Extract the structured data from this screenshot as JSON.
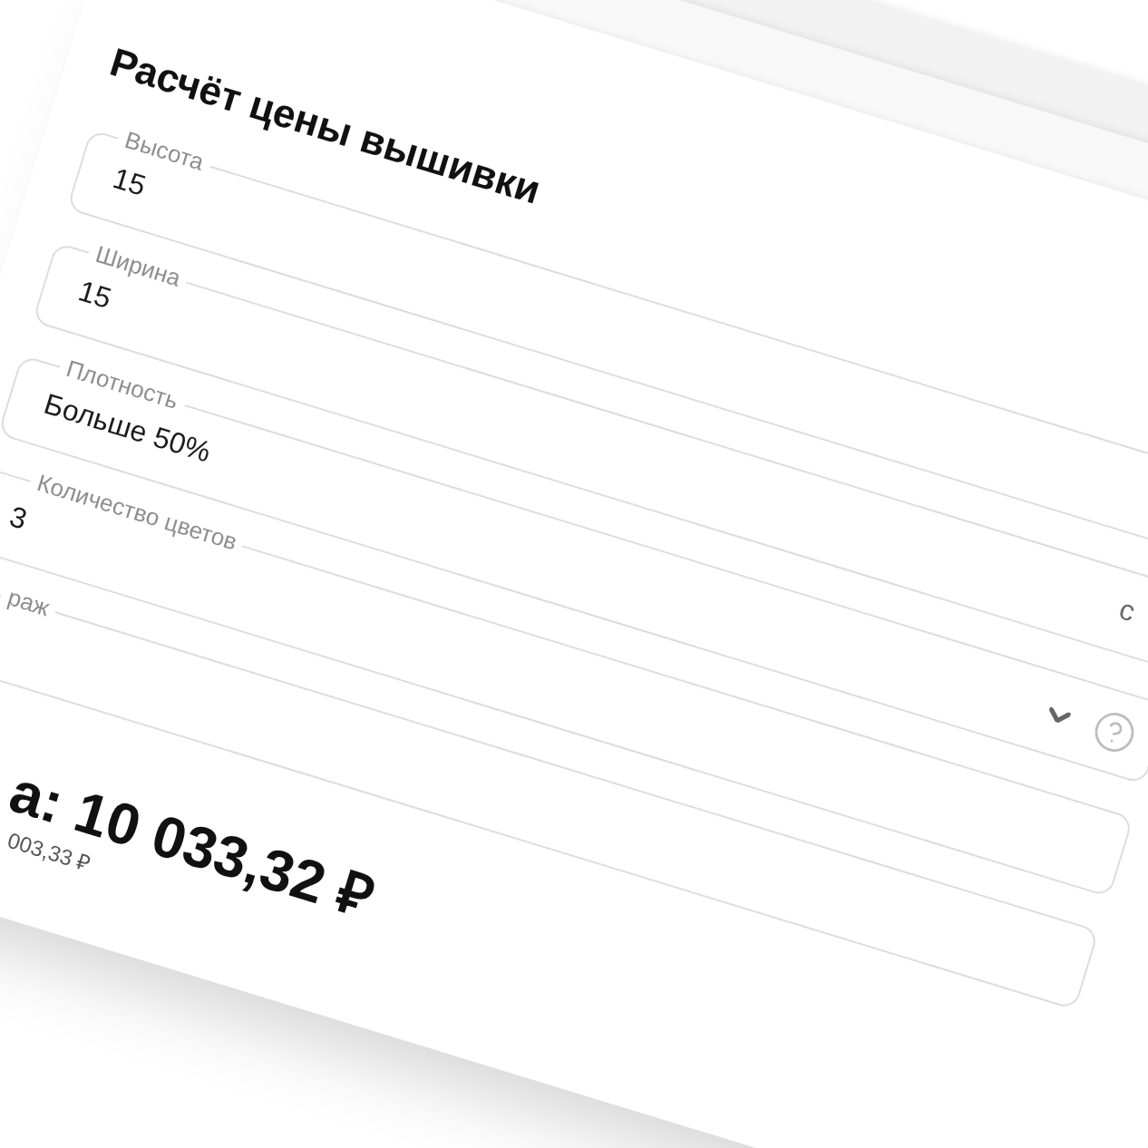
{
  "title": "Расчёт цены вышивки",
  "fields": [
    {
      "kind": "input",
      "label": "Высота",
      "value": "15"
    },
    {
      "kind": "input",
      "label": "Ширина",
      "value": "15",
      "suffix": "с"
    },
    {
      "kind": "select",
      "label": "Плотность",
      "value": "Больше 50%",
      "help": true
    },
    {
      "kind": "input",
      "label": "Количество цветов",
      "value": "3"
    },
    {
      "kind": "input",
      "label": "раж"
    }
  ],
  "total": {
    "price": "а: 10 033,32 ₽",
    "per_item": "003,33 ₽"
  }
}
